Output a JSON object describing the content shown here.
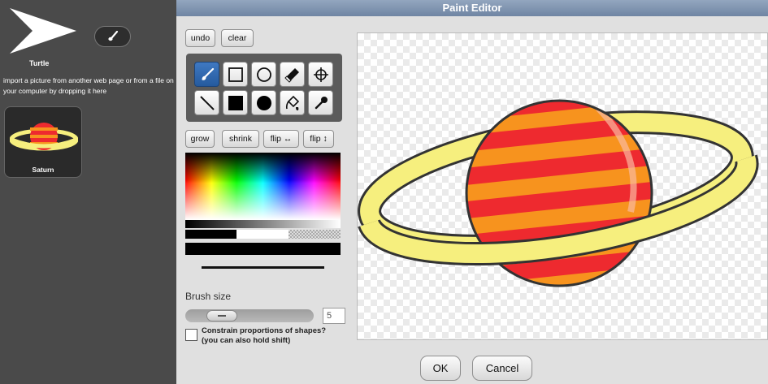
{
  "sprite": {
    "name": "Turtle",
    "import_hint": "import a picture from another web page or from a file on your computer by dropping it here"
  },
  "costumes": [
    {
      "name": "Saturn"
    }
  ],
  "dialog": {
    "title": "Paint Editor",
    "undo": "undo",
    "clear": "clear",
    "grow": "grow",
    "shrink": "shrink",
    "flip_h": "flip ↔",
    "flip_v": "flip ↕",
    "tools": [
      "brush-icon",
      "rectangle-icon",
      "ellipse-icon",
      "eraser-icon",
      "crosshairs-icon",
      "line-icon",
      "filled-rectangle-icon",
      "filled-ellipse-icon",
      "paint-bucket-icon",
      "eyedropper-icon"
    ],
    "active_tool": "brush-icon",
    "current_color": "#000000",
    "brush_size_label": "Brush size",
    "brush_size": "5",
    "constrain_label_1": "Constrain proportions of shapes?",
    "constrain_label_2": "(you can also hold shift)",
    "constrain_checked": false,
    "ok": "OK",
    "cancel": "Cancel"
  },
  "colors": {
    "titlebar": "#7d91ad",
    "planet_red": "#ee2a2f",
    "planet_orange": "#f7931e",
    "ring_yellow": "#f6ef7e",
    "accent_tool": "#2f6bb5"
  }
}
